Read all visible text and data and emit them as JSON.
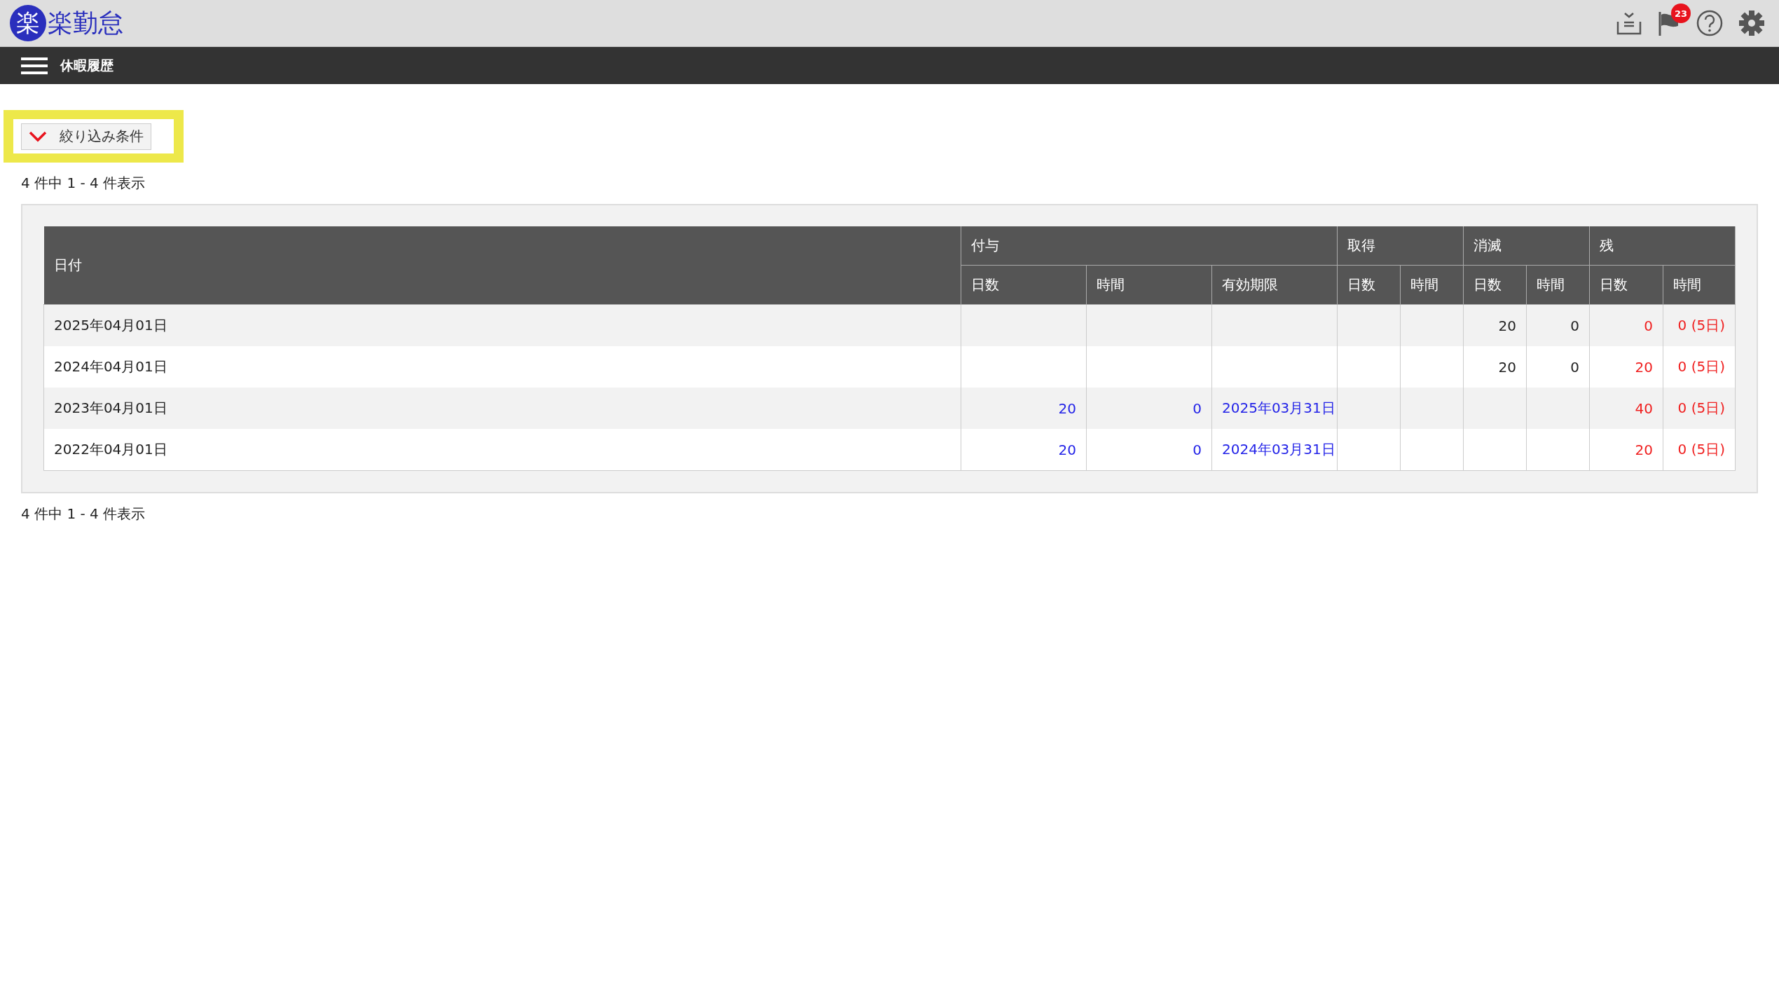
{
  "header": {
    "logo_mark": "楽",
    "logo_text": "楽勤怠",
    "notification_count": "23"
  },
  "nav": {
    "title": "休暇履歴"
  },
  "filter": {
    "label": "絞り込み条件",
    "expanded": false
  },
  "count_top": "4 件中 1 - 4 件表示",
  "table": {
    "header": {
      "date": "日付",
      "grant": {
        "label": "付与",
        "days": "日数",
        "hours": "時間",
        "expiry": "有効期限"
      },
      "taken": {
        "label": "取得",
        "days": "日数",
        "hours": "時間"
      },
      "lapsed": {
        "label": "消滅",
        "days": "日数",
        "hours": "時間"
      },
      "remaining": {
        "label": "残",
        "days": "日数",
        "hours": "時間"
      }
    },
    "rows": [
      {
        "date": "2025年04月01日",
        "lapsed": {
          "days": "20",
          "hours": "0"
        },
        "remaining": {
          "days": "0",
          "hours": "0 (5日)"
        }
      },
      {
        "date": "2024年04月01日",
        "lapsed": {
          "days": "20",
          "hours": "0"
        },
        "remaining": {
          "days": "20",
          "hours": "0 (5日)"
        }
      },
      {
        "date": "2023年04月01日",
        "grant": {
          "days": "20",
          "hours": "0",
          "expiry": "2025年03月31日"
        },
        "remaining": {
          "days": "40",
          "hours": "0 (5日)"
        }
      },
      {
        "date": "2022年04月01日",
        "grant": {
          "days": "20",
          "hours": "0",
          "expiry": "2024年03月31日"
        },
        "remaining": {
          "days": "20",
          "hours": "0 (5日)"
        }
      }
    ]
  },
  "count_bottom": "4 件中 1 - 4 件表示"
}
